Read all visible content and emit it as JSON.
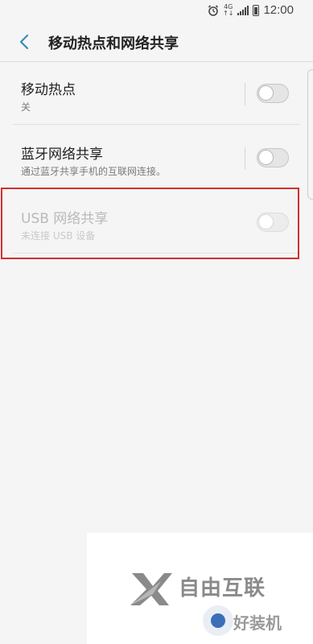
{
  "status_bar": {
    "network": "4G",
    "time": "12:00",
    "icons": [
      "alarm-icon",
      "signal-icon",
      "battery-icon"
    ]
  },
  "header": {
    "title": "移动热点和网络共享",
    "back_icon": "chevron-left-icon"
  },
  "settings": [
    {
      "title": "移动热点",
      "subtitle": "关",
      "enabled": true,
      "toggle_on": false
    },
    {
      "title": "蓝牙网络共享",
      "subtitle": "通过蓝牙共享手机的互联网连接。",
      "enabled": true,
      "toggle_on": false
    },
    {
      "title": "USB 网络共享",
      "subtitle": "未连接 USB 设备",
      "enabled": false,
      "toggle_on": false
    }
  ],
  "watermark": {
    "brand_text": "自由互联",
    "secondary_text": "好装机"
  },
  "colors": {
    "background": "#f5f5f5",
    "highlight": "#d32f2f",
    "back_icon": "#3a8ab8"
  }
}
